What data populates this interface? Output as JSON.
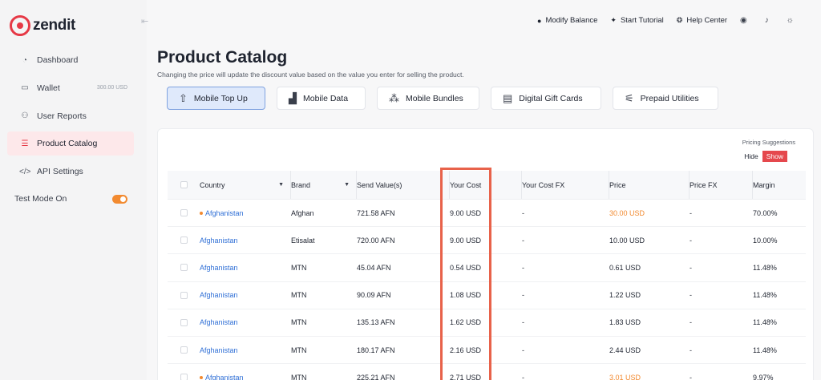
{
  "brand": {
    "name": "zendit",
    "accent": "#e63946"
  },
  "sidebar": {
    "items": [
      {
        "label": "Dashboard",
        "icon": "dashboard-icon",
        "glyph": "◔"
      },
      {
        "label": "Wallet",
        "icon": "wallet-icon",
        "glyph": "▭",
        "extra": "300.00 USD"
      },
      {
        "label": "User Reports",
        "icon": "users-icon",
        "glyph": "⚇"
      },
      {
        "label": "Product Catalog",
        "icon": "list-icon",
        "glyph": "☰",
        "active": true
      },
      {
        "label": "API Settings",
        "icon": "code-icon",
        "glyph": "</>"
      }
    ],
    "test_mode_label": "Test Mode On"
  },
  "topbar": {
    "modify_balance": "Modify Balance",
    "start_tutorial": "Start Tutorial",
    "help_center": "Help Center"
  },
  "page": {
    "title": "Product Catalog",
    "subtitle": "Changing the price will update the discount value based on the value you enter for selling the product."
  },
  "tabs": [
    {
      "label": "Mobile Top Up",
      "icon": "mobile-topup-icon",
      "glyph": "⇧",
      "active": true
    },
    {
      "label": "Mobile Data",
      "icon": "signal-icon",
      "glyph": "▟"
    },
    {
      "label": "Mobile Bundles",
      "icon": "bundles-icon",
      "glyph": "⁂"
    },
    {
      "label": "Digital Gift Cards",
      "icon": "gift-card-icon",
      "glyph": "▤"
    },
    {
      "label": "Prepaid Utilities",
      "icon": "utilities-icon",
      "glyph": "⚟"
    }
  ],
  "pricing": {
    "label": "Pricing Suggestions",
    "hide": "Hide",
    "show": "Show"
  },
  "table": {
    "columns": [
      "Country",
      "Brand",
      "Send Value(s)",
      "Your Cost",
      "Your Cost FX",
      "Price",
      "Price FX",
      "Margin"
    ],
    "rows": [
      {
        "country": "Afghanistan",
        "dot": true,
        "brand": "Afghan",
        "send": "721.58 AFN",
        "cost": "9.00 USD",
        "cost_fx": "-",
        "price": "30.00 USD",
        "price_orange": true,
        "price_fx": "-",
        "margin": "70.00%"
      },
      {
        "country": "Afghanistan",
        "dot": false,
        "brand": "Etisalat",
        "send": "720.00 AFN",
        "cost": "9.00 USD",
        "cost_fx": "-",
        "price": "10.00 USD",
        "price_orange": false,
        "price_fx": "-",
        "margin": "10.00%"
      },
      {
        "country": "Afghanistan",
        "dot": false,
        "brand": "MTN",
        "send": "45.04 AFN",
        "cost": "0.54 USD",
        "cost_fx": "-",
        "price": "0.61 USD",
        "price_orange": false,
        "price_fx": "-",
        "margin": "11.48%"
      },
      {
        "country": "Afghanistan",
        "dot": false,
        "brand": "MTN",
        "send": "90.09 AFN",
        "cost": "1.08 USD",
        "cost_fx": "-",
        "price": "1.22 USD",
        "price_orange": false,
        "price_fx": "-",
        "margin": "11.48%"
      },
      {
        "country": "Afghanistan",
        "dot": false,
        "brand": "MTN",
        "send": "135.13 AFN",
        "cost": "1.62 USD",
        "cost_fx": "-",
        "price": "1.83 USD",
        "price_orange": false,
        "price_fx": "-",
        "margin": "11.48%"
      },
      {
        "country": "Afghanistan",
        "dot": false,
        "brand": "MTN",
        "send": "180.17 AFN",
        "cost": "2.16 USD",
        "cost_fx": "-",
        "price": "2.44 USD",
        "price_orange": false,
        "price_fx": "-",
        "margin": "11.48%"
      },
      {
        "country": "Afghanistan",
        "dot": true,
        "brand": "MTN",
        "send": "225.21 AFN",
        "cost": "2.71 USD",
        "cost_fx": "-",
        "price": "3.01 USD",
        "price_orange": true,
        "price_fx": "-",
        "margin": "9.97%"
      }
    ]
  }
}
